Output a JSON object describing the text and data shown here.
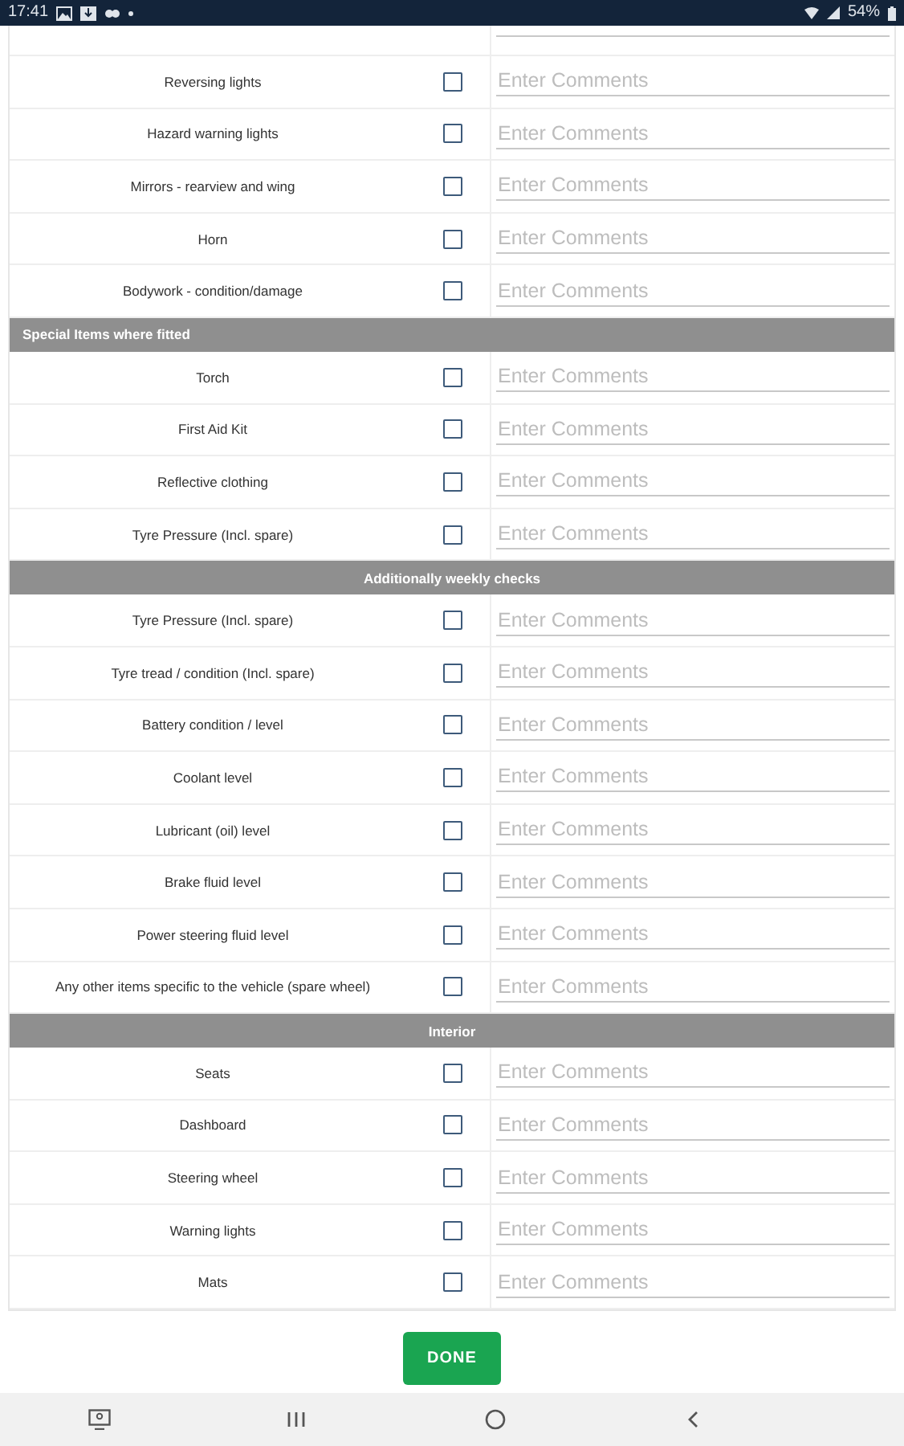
{
  "status_bar": {
    "time": "17:41",
    "battery": "54%"
  },
  "sections": [
    {
      "kind": "untitled",
      "rows": [
        {
          "label": "Reversing lights",
          "checked": false,
          "placeholder": "Enter Comments"
        },
        {
          "label": "Hazard warning lights",
          "checked": false,
          "placeholder": "Enter Comments"
        },
        {
          "label": "Mirrors - rearview and wing",
          "checked": false,
          "placeholder": "Enter Comments"
        },
        {
          "label": "Horn",
          "checked": false,
          "placeholder": "Enter Comments"
        },
        {
          "label": "Bodywork - condition/damage",
          "checked": false,
          "placeholder": "Enter Comments"
        }
      ]
    },
    {
      "title": "Special Items where fitted",
      "kind": "subheading",
      "rows": [
        {
          "label": "Torch",
          "checked": false,
          "placeholder": "Enter Comments"
        },
        {
          "label": "First Aid Kit",
          "checked": false,
          "placeholder": "Enter Comments"
        },
        {
          "label": "Reflective clothing",
          "checked": false,
          "placeholder": "Enter Comments"
        },
        {
          "label": "Tyre Pressure (Incl. spare)",
          "checked": false,
          "placeholder": "Enter Comments"
        }
      ]
    },
    {
      "title": "Additionally weekly checks",
      "kind": "heading",
      "rows": [
        {
          "label": "Tyre Pressure (Incl. spare)",
          "checked": false,
          "placeholder": "Enter Comments"
        },
        {
          "label": "Tyre tread / condition (Incl. spare)",
          "checked": false,
          "placeholder": "Enter Comments"
        },
        {
          "label": "Battery condition / level",
          "checked": false,
          "placeholder": "Enter Comments"
        },
        {
          "label": "Coolant level",
          "checked": false,
          "placeholder": "Enter Comments"
        },
        {
          "label": "Lubricant (oil) level",
          "checked": false,
          "placeholder": "Enter Comments"
        },
        {
          "label": "Brake fluid level",
          "checked": false,
          "placeholder": "Enter Comments"
        },
        {
          "label": "Power steering fluid level",
          "checked": false,
          "placeholder": "Enter Comments"
        },
        {
          "label": "Any other items specific to the vehicle (spare wheel)",
          "checked": false,
          "placeholder": "Enter Comments"
        }
      ]
    },
    {
      "title": "Interior",
      "kind": "heading",
      "rows": [
        {
          "label": "Seats",
          "checked": false,
          "placeholder": "Enter Comments"
        },
        {
          "label": "Dashboard",
          "checked": false,
          "placeholder": "Enter Comments"
        },
        {
          "label": "Steering wheel",
          "checked": false,
          "placeholder": "Enter Comments"
        },
        {
          "label": "Warning lights",
          "checked": false,
          "placeholder": "Enter Comments"
        },
        {
          "label": "Mats",
          "checked": false,
          "placeholder": "Enter Comments"
        }
      ]
    }
  ],
  "done_button": "DONE"
}
